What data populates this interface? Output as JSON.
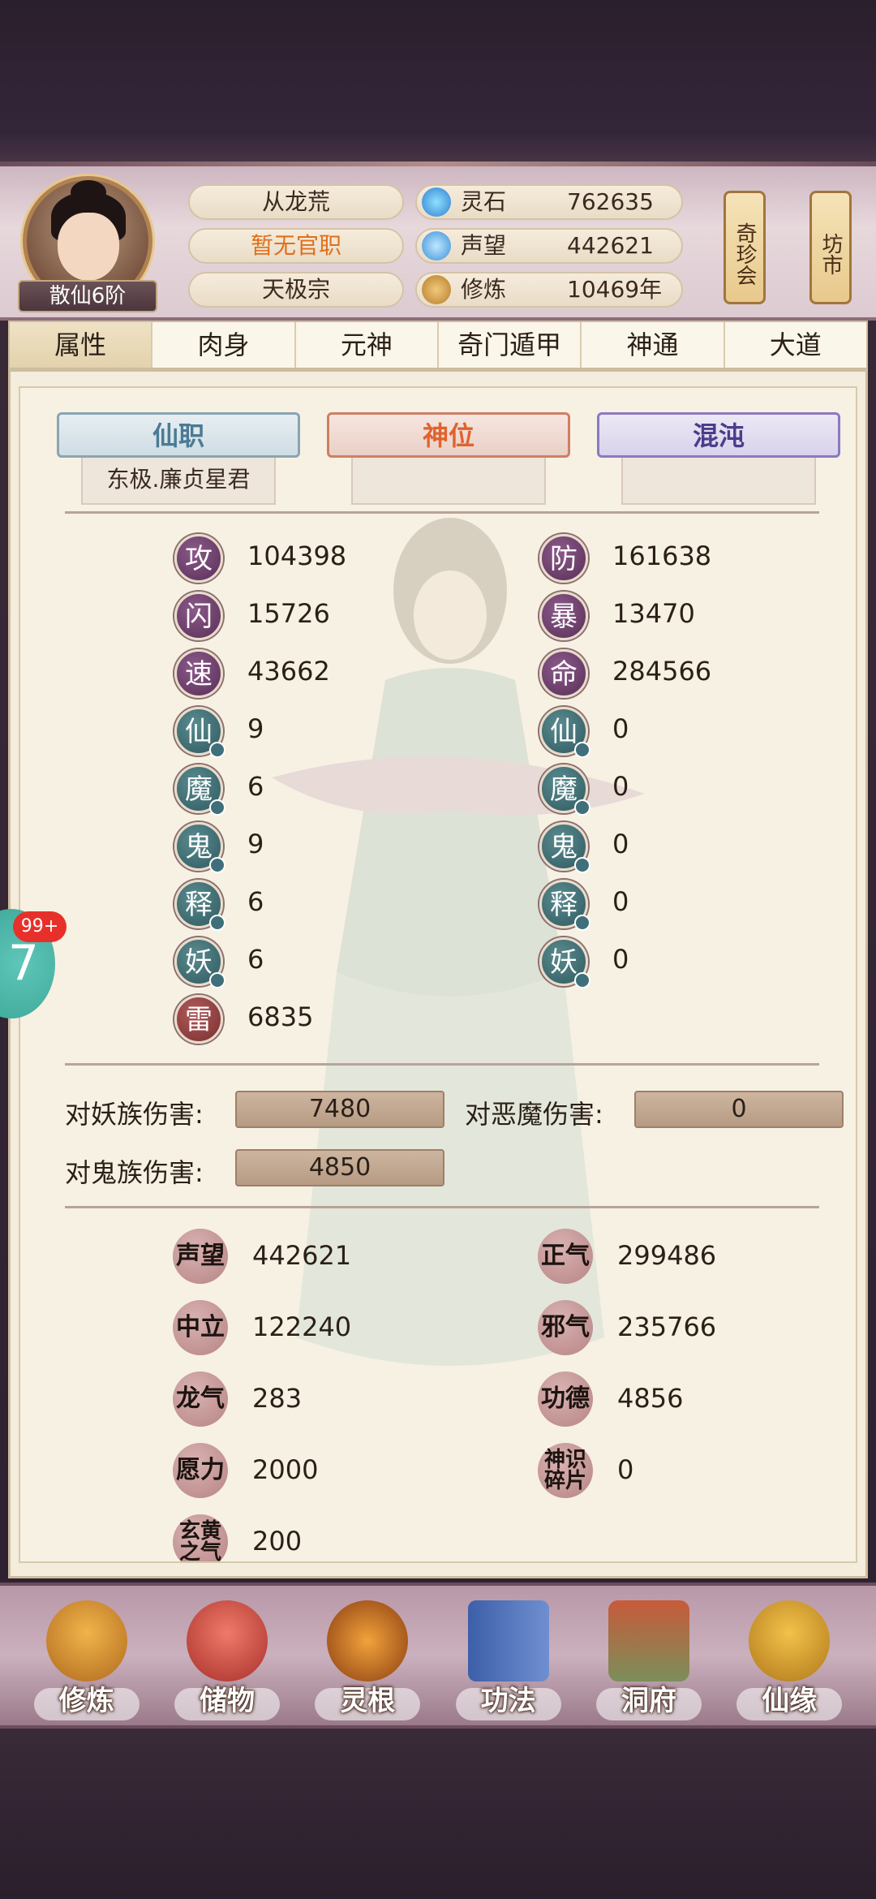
{
  "header": {
    "rank": "散仙6阶",
    "name": "从龙荒",
    "office": "暂无官职",
    "sect": "天极宗",
    "resources": [
      {
        "label": "灵石",
        "value": "762635",
        "icon": "spirit-stone-icon"
      },
      {
        "label": "声望",
        "value": "442621",
        "icon": "prestige-icon"
      },
      {
        "label": "修炼",
        "value": "10469年",
        "icon": "meditation-icon"
      }
    ],
    "buttons": {
      "treasure": "奇珍会",
      "market": "坊市"
    }
  },
  "tabs": [
    "属性",
    "肉身",
    "元神",
    "奇门遁甲",
    "神通",
    "大道"
  ],
  "titles": {
    "immortal_post": {
      "label": "仙职",
      "value": "东极.廉贞星君"
    },
    "divine_seat": {
      "label": "神位",
      "value": ""
    },
    "chaos": {
      "label": "混沌",
      "value": ""
    }
  },
  "stats": {
    "left": [
      {
        "icon": "攻",
        "value": "104398"
      },
      {
        "icon": "闪",
        "value": "15726"
      },
      {
        "icon": "速",
        "value": "43662"
      },
      {
        "icon": "仙",
        "value": "9"
      },
      {
        "icon": "魔",
        "value": "6"
      },
      {
        "icon": "鬼",
        "value": "9"
      },
      {
        "icon": "释",
        "value": "6"
      },
      {
        "icon": "妖",
        "value": "6"
      },
      {
        "icon": "雷",
        "value": "6835"
      }
    ],
    "right": [
      {
        "icon": "防",
        "value": "161638"
      },
      {
        "icon": "暴",
        "value": "13470"
      },
      {
        "icon": "命",
        "value": "284566"
      },
      {
        "icon": "仙",
        "value": "0"
      },
      {
        "icon": "魔",
        "value": "0"
      },
      {
        "icon": "鬼",
        "value": "0"
      },
      {
        "icon": "释",
        "value": "0"
      },
      {
        "icon": "妖",
        "value": "0"
      }
    ]
  },
  "damage": {
    "vs_yao_label": "对妖族伤害:",
    "vs_yao": "7480",
    "vs_demon_label": "对恶魔伤害:",
    "vs_demon": "0",
    "vs_ghost_label": "对鬼族伤害:",
    "vs_ghost": "4850"
  },
  "attributes": {
    "left": [
      {
        "icon": "声望",
        "value": "442621"
      },
      {
        "icon": "中立",
        "value": "122240"
      },
      {
        "icon": "龙气",
        "value": "283"
      },
      {
        "icon": "愿力",
        "value": "2000"
      },
      {
        "icon": "玄黄之气",
        "value": "200"
      }
    ],
    "right": [
      {
        "icon": "正气",
        "value": "299486"
      },
      {
        "icon": "邪气",
        "value": "235766"
      },
      {
        "icon": "功德",
        "value": "4856"
      },
      {
        "icon": "神识碎片",
        "value": "0"
      }
    ]
  },
  "side": {
    "badge": "99+",
    "glyph": "7"
  },
  "nav": [
    "修炼",
    "储物",
    "灵根",
    "功法",
    "洞府",
    "仙缘"
  ]
}
